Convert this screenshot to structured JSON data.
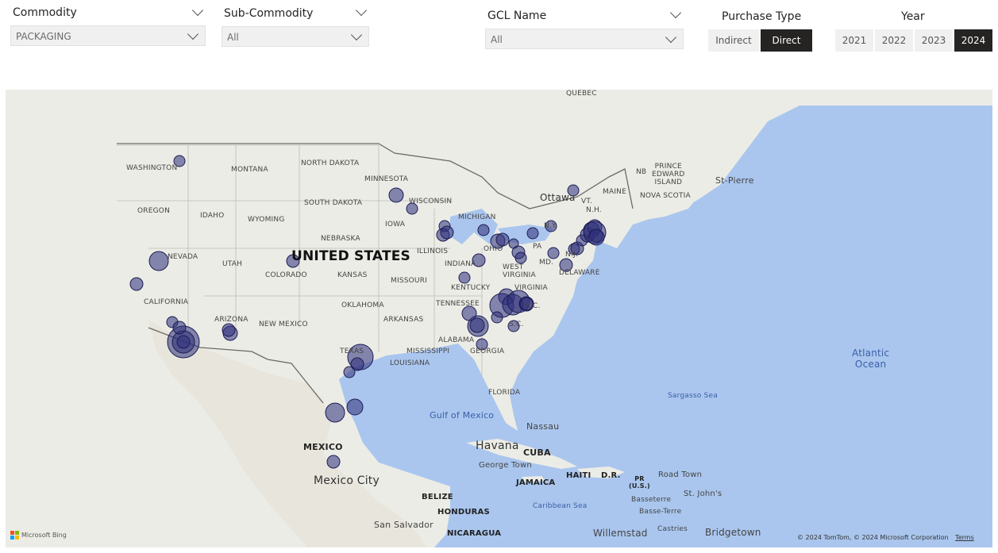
{
  "filters": {
    "commodity": {
      "title": "Commodity",
      "value": "PACKAGING"
    },
    "sub_commodity": {
      "title": "Sub-Commodity",
      "value": "All"
    },
    "gcl_name": {
      "title": "GCL Name",
      "value": "All"
    },
    "purchase_type": {
      "title": "Purchase Type",
      "options": [
        "Indirect",
        "Direct"
      ],
      "selected": "Direct"
    },
    "year": {
      "title": "Year",
      "options": [
        "2021",
        "2022",
        "2023",
        "2024"
      ],
      "selected": "2024"
    }
  },
  "map": {
    "country_labels": {
      "usa": "UNITED STATES",
      "mexico": "MEXICO",
      "cuba": "CUBA",
      "jamaica": "JAMAICA",
      "haiti": "HAITI",
      "dr": "D.R.",
      "pr": "PR\n(U.S.)",
      "belize": "BELIZE",
      "honduras": "HONDURAS",
      "nicaragua": "NICARAGUA"
    },
    "state_labels": {
      "quebec": "QUEBEC",
      "washington": "WASHINGTON",
      "montana": "MONTANA",
      "north_dakota": "NORTH DAKOTA",
      "minnesota": "MINNESOTA",
      "south_dakota": "SOUTH DAKOTA",
      "wisconsin": "WISCONSIN",
      "oregon": "OREGON",
      "idaho": "IDAHO",
      "wyoming": "WYOMING",
      "michigan": "MICHIGAN",
      "iowa": "IOWA",
      "nebraska": "NEBRASKA",
      "nevada": "NEVADA",
      "utah": "UTAH",
      "illinois": "ILLINOIS",
      "indiana": "INDIANA",
      "ohio": "OHIO",
      "pa": "PA",
      "ny": "N.Y.",
      "nj": "N.J.",
      "md": "MD.",
      "delaware": "DELAWARE",
      "colorado": "COLORADO",
      "kansas": "KANSAS",
      "missouri": "MISSOURI",
      "west_virginia": "WEST\nVIRGINIA",
      "kentucky": "KENTUCKY",
      "virginia": "VIRGINIA",
      "california": "CALIFORNIA",
      "tennessee": "TENNESSEE",
      "nc": "N.C.",
      "sc": "S.C.",
      "oklahoma": "OKLAHOMA",
      "arkansas": "ARKANSAS",
      "arizona": "ARIZONA",
      "new_mexico": "NEW MEXICO",
      "alabama": "ALABAMA",
      "georgia": "GEORGIA",
      "mississippi": "MISSISSIPPI",
      "texas": "TEXAS",
      "louisiana": "LOUISIANA",
      "florida": "FLORIDA",
      "maine": "MAINE",
      "vt": "VT.",
      "nh": "N.H.",
      "nb": "NB",
      "pei": "PRINCE\nEDWARD\nISLAND",
      "nova_scotia": "NOVA SCOTIA"
    },
    "city_labels": {
      "ottawa": "Ottawa",
      "st_pierre": "St-Pierre",
      "nassau": "Nassau",
      "havana": "Havana",
      "george_town": "George Town",
      "mexico_city": "Mexico City",
      "road_town": "Road Town",
      "st_johns": "St. John's",
      "basseterre": "Basseterre",
      "basse_terre": "Basse-Terre",
      "castries": "Castries",
      "bridgetown": "Bridgetown",
      "willemstad": "Willemstad",
      "san_salvador": "San Salvador"
    },
    "water_labels": {
      "gulf": "Gulf of Mexico",
      "atlantic": "Atlantic\nOcean",
      "sargasso": "Sargasso Sea",
      "caribbean": "Caribbean Sea"
    },
    "bubble_color": "#2e2f7a",
    "copyright": "© 2024 TomTom, © 2024 Microsoft Corporation",
    "terms_link": "Terms",
    "bing_logo": "Microsoft Bing"
  }
}
